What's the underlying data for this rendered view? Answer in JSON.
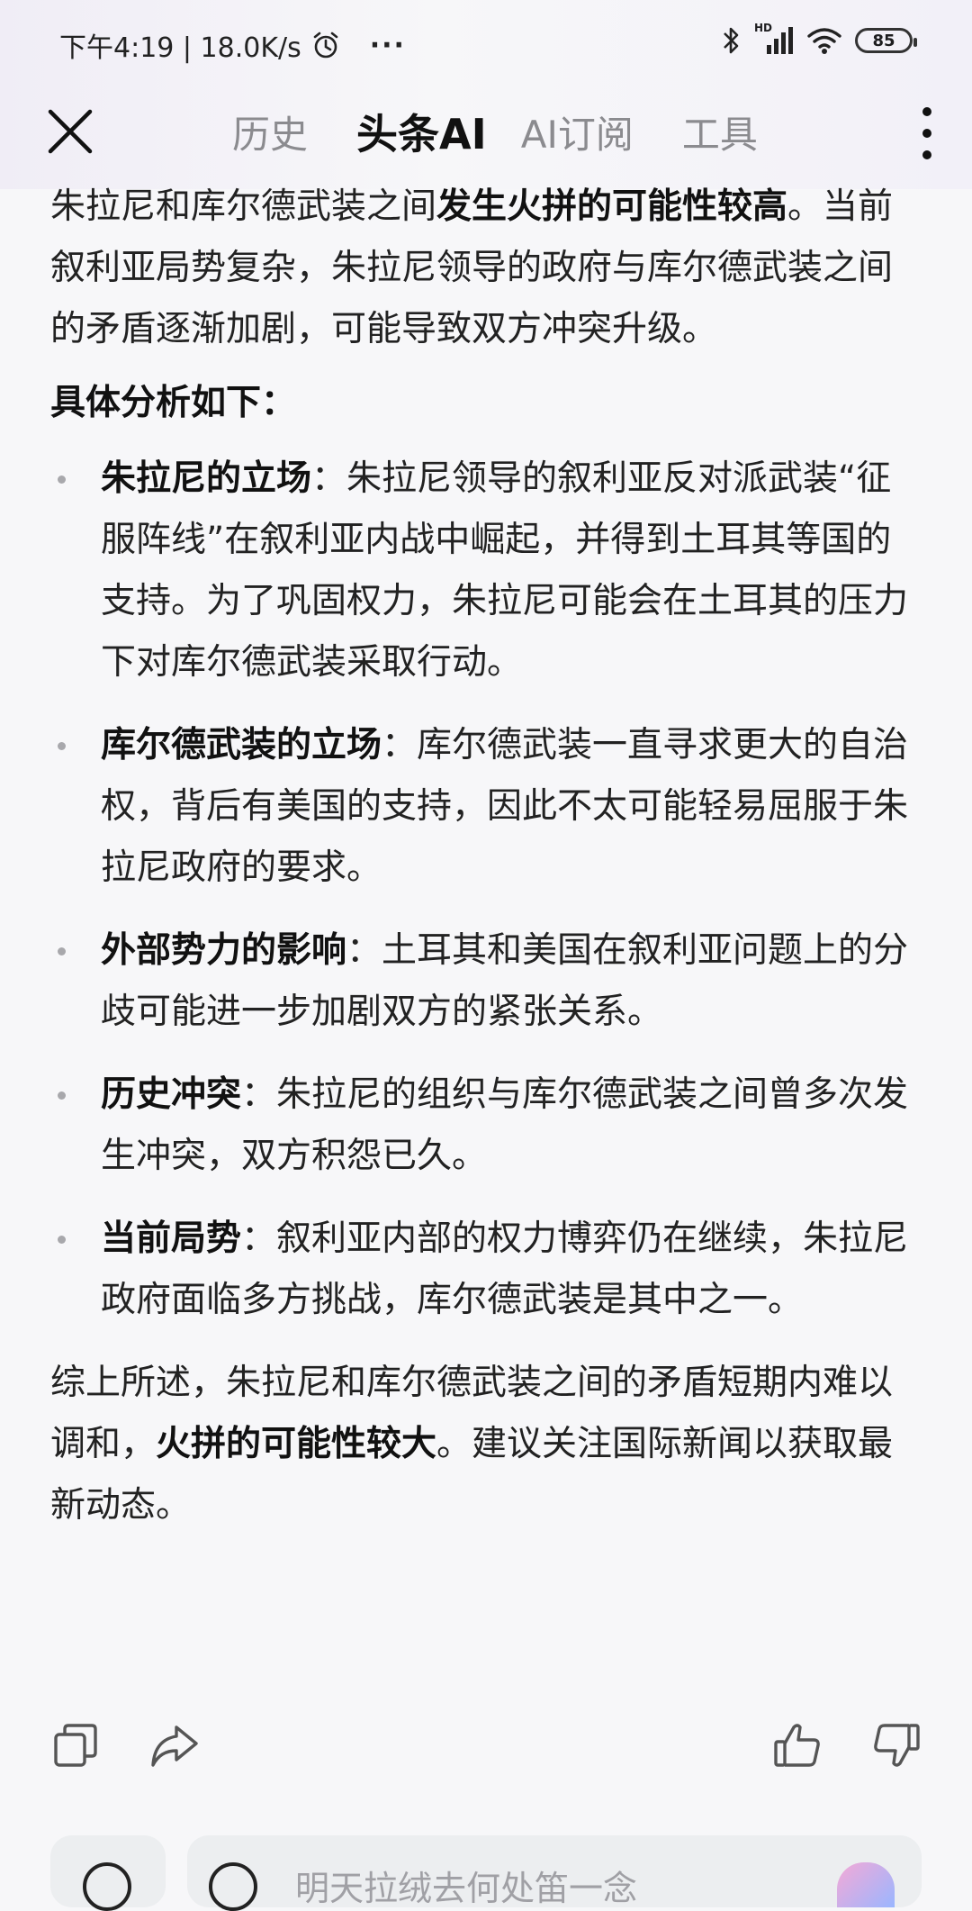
{
  "status_bar": {
    "time_speed": "下午4:19 | 18.0K/s",
    "more_dots": "···",
    "battery": "85",
    "network_label": "HD"
  },
  "nav": {
    "tabs": [
      {
        "label": "历史",
        "active": false
      },
      {
        "label": "头条AI",
        "active": true
      },
      {
        "label": "AI订阅",
        "active": false
      },
      {
        "label": "工具",
        "active": false
      }
    ]
  },
  "answer": {
    "intro_plain": "朱拉尼和库尔德武装之间",
    "intro_bold": "发生火拼的可能性较高",
    "intro_end": "。当前叙利亚局势复杂，朱拉尼领导的政府与库尔德武装之间的矛盾逐渐加剧，可能导致双方冲突升级。",
    "analysis_heading": "具体分析如下：",
    "points": [
      {
        "title": "朱拉尼的立场",
        "text": "：朱拉尼领导的叙利亚反对派武装“征服阵线”在叙利亚内战中崛起，并得到土耳其等国的支持。为了巩固权力，朱拉尼可能会在土耳其的压力下对库尔德武装采取行动。"
      },
      {
        "title": "库尔德武装的立场",
        "text": "：库尔德武装一直寻求更大的自治权，背后有美国的支持，因此不太可能轻易屈服于朱拉尼政府的要求。"
      },
      {
        "title": "外部势力的影响",
        "text": "：土耳其和美国在叙利亚问题上的分歧可能进一步加剧双方的紧张关系。"
      },
      {
        "title": "历史冲突",
        "text": "：朱拉尼的组织与库尔德武装之间曾多次发生冲突，双方积怨已久。"
      },
      {
        "title": "当前局势",
        "text": "：叙利亚内部的权力博弈仍在继续，朱拉尼政府面临多方挑战，库尔德武装是其中之一。"
      }
    ],
    "conclusion_plain": "综上所述，朱拉尼和库尔德武装之间的矛盾短期内难以调和，",
    "conclusion_bold": "火拼的可能性较大",
    "conclusion_end": "。建议关注国际新闻以获取最新动态。"
  },
  "input": {
    "placeholder": "明天拉绒去何处笛一念"
  },
  "icons": {
    "close": "close-icon",
    "menu": "more-vertical-icon",
    "copy": "copy-icon",
    "share": "share-icon",
    "like": "thumbs-up-icon",
    "dislike": "thumbs-down-icon"
  }
}
